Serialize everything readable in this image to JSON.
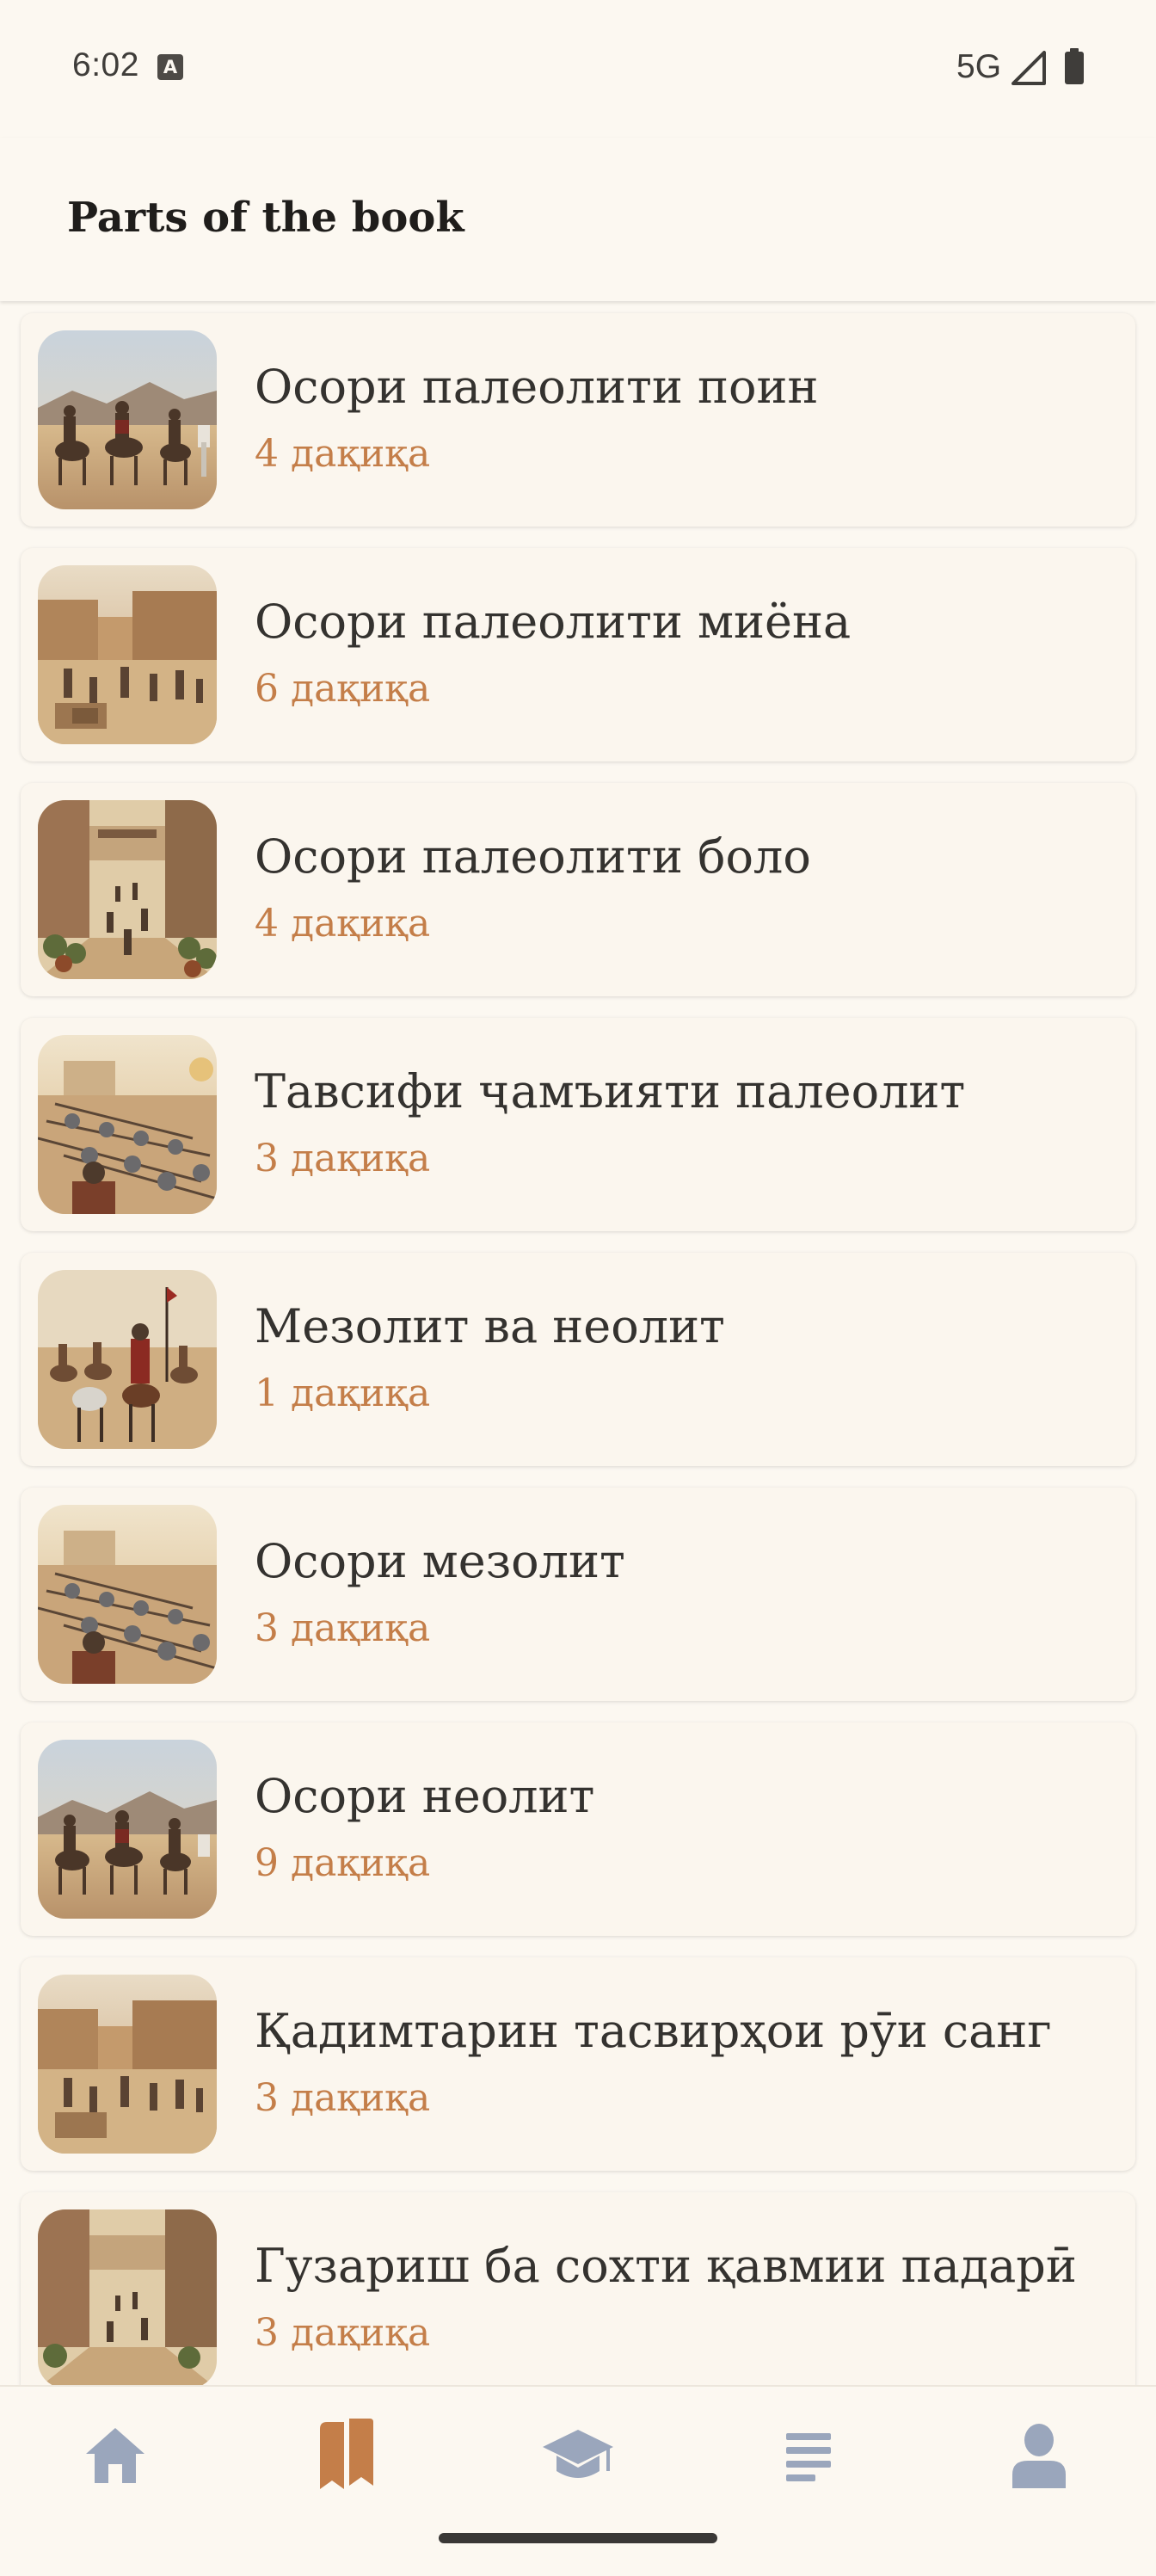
{
  "status_bar": {
    "time": "6:02",
    "notification_icon": "a-icon",
    "network": "5G",
    "signal_icon": "signal-icon",
    "battery_icon": "battery-icon"
  },
  "header": {
    "title": "Parts of the book"
  },
  "chapters": [
    {
      "title": "Осори палеолити поин",
      "duration": "4 дақиқа"
    },
    {
      "title": "Осори палеолити миёна",
      "duration": "6 дақиқа"
    },
    {
      "title": "Осори палеолити боло",
      "duration": "4 дақиқа"
    },
    {
      "title": "Тавсифи ҷамъияти палеолит",
      "duration": "3 дақиқа"
    },
    {
      "title": "Мезолит ва неолит",
      "duration": "1 дақиқа"
    },
    {
      "title": "Осори мезолит",
      "duration": "3 дақиқа"
    },
    {
      "title": "Осори неолит",
      "duration": "9 дақиқа"
    },
    {
      "title": "Қадимтарин тасвирҳои рӯи санг",
      "duration": "3 дақиқа"
    },
    {
      "title": "Гузариш ба сохти қавмии падарӣ",
      "duration": "3 дақиқа"
    }
  ],
  "bottom_nav": [
    {
      "icon": "home-icon",
      "active": false
    },
    {
      "icon": "bookmarks-icon",
      "active": true
    },
    {
      "icon": "graduation-cap-icon",
      "active": false
    },
    {
      "icon": "list-icon",
      "active": false
    },
    {
      "icon": "profile-icon",
      "active": false
    }
  ],
  "colors": {
    "background": "#fcf8f1",
    "accent": "#c47e49",
    "nav_inactive": "#9aa6bc",
    "text": "#34322f"
  }
}
